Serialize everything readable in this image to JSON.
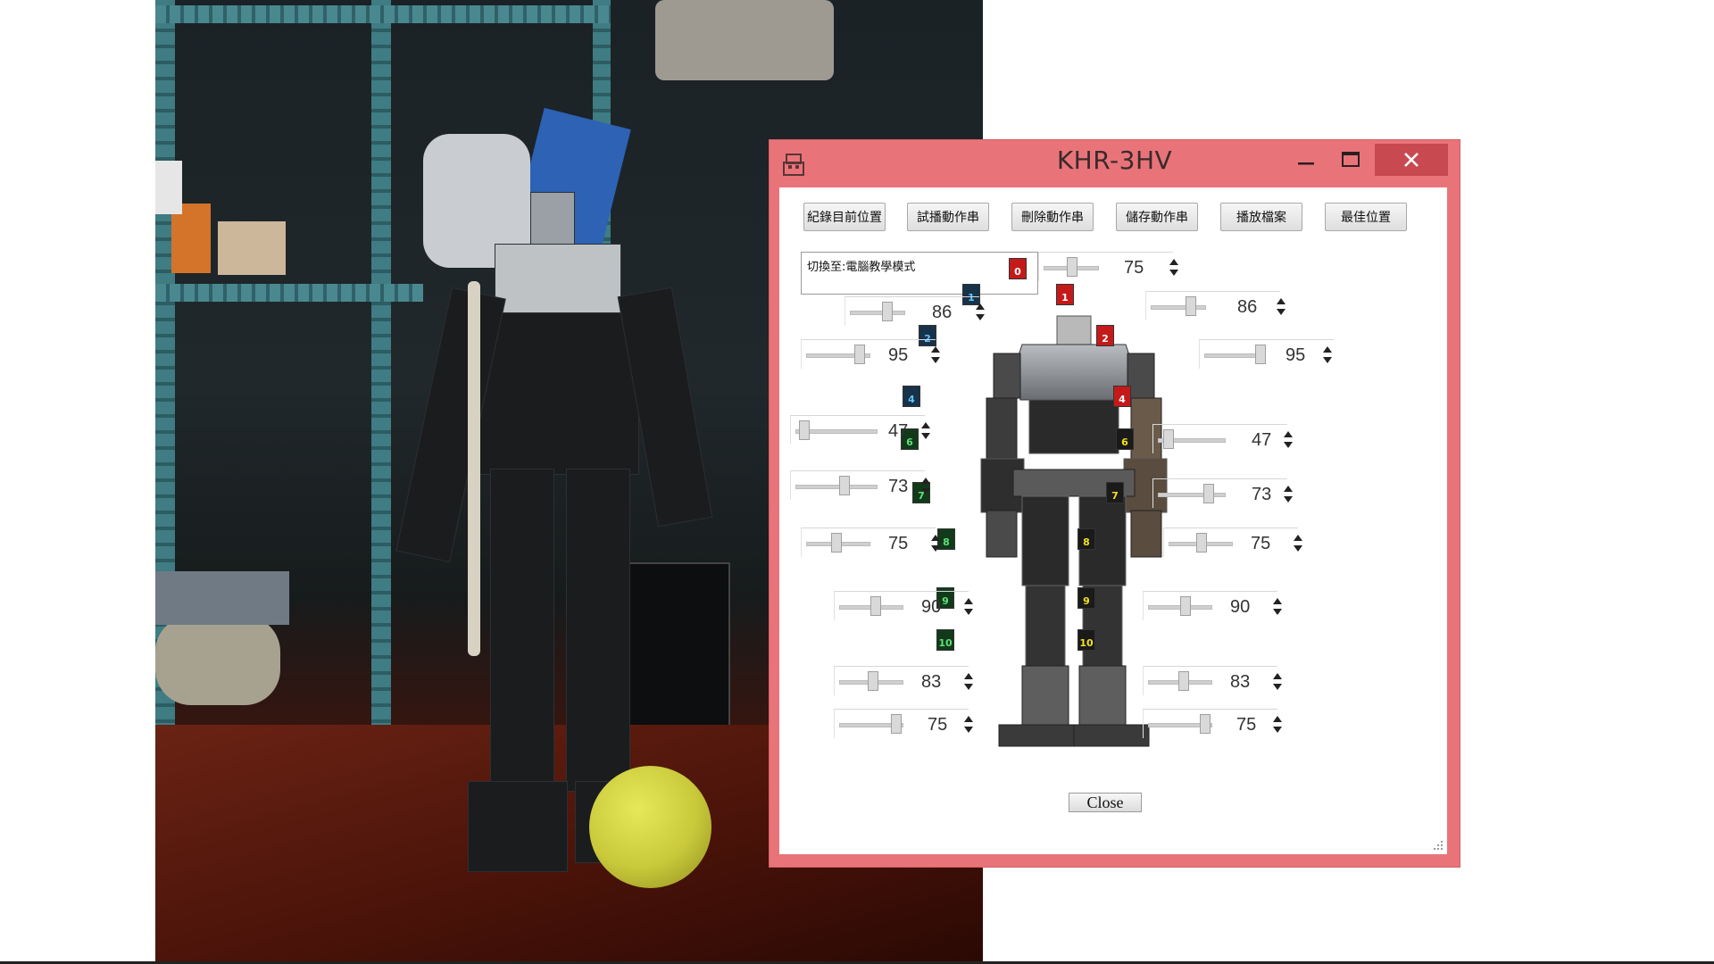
{
  "window": {
    "title": "KHR-3HV"
  },
  "toolbar": {
    "buttons": [
      "紀錄目前位置",
      "試播動作串",
      "刪除動作串",
      "儲存動作串",
      "播放檔案",
      "最佳位置"
    ]
  },
  "status_text": "切換至:電腦教學模式",
  "servos": [
    {
      "id": "0",
      "value": "75",
      "color": "red"
    },
    {
      "id": "1",
      "value": "86",
      "color": "blue"
    },
    {
      "id": "1",
      "value": "86",
      "color": "red"
    },
    {
      "id": "2",
      "value": "95",
      "color": "blue"
    },
    {
      "id": "2",
      "value": "95",
      "color": "red"
    },
    {
      "id": "4",
      "value": "47",
      "color": "blue"
    },
    {
      "id": "4",
      "value": "47",
      "color": "red"
    },
    {
      "id": "6",
      "value": "73",
      "color": "green"
    },
    {
      "id": "6",
      "value": "73",
      "color": "yellow"
    },
    {
      "id": "7",
      "value": "75",
      "color": "green"
    },
    {
      "id": "7",
      "value": "75",
      "color": "yellow"
    },
    {
      "id": "8",
      "value": "90",
      "color": "green"
    },
    {
      "id": "8",
      "value": "90",
      "color": "yellow"
    },
    {
      "id": "9",
      "value": "83",
      "color": "green"
    },
    {
      "id": "9",
      "value": "83",
      "color": "yellow"
    },
    {
      "id": "10",
      "value": "75",
      "color": "green"
    },
    {
      "id": "10",
      "value": "75",
      "color": "yellow"
    }
  ],
  "close_label": "Close",
  "colors": {
    "window_frame": "#e8747a",
    "close_button": "#c8494f"
  }
}
